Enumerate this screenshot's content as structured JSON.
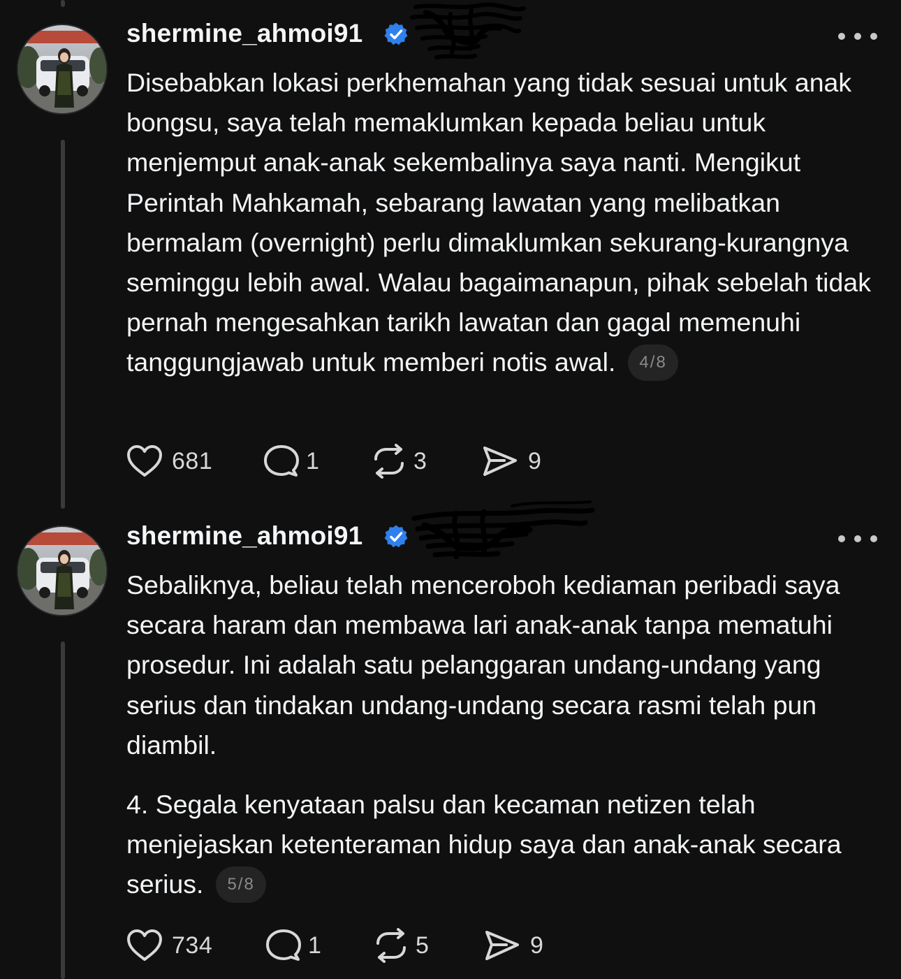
{
  "posts": [
    {
      "username": "shermine_ahmoi91",
      "verified": true,
      "paragraphs": [
        "Disebabkan lokasi perkhemahan yang tidak sesuai untuk anak bongsu, saya telah memaklumkan kepada beliau untuk menjemput anak-anak sekembalinya saya nanti. Mengikut Perintah Mahkamah, sebarang lawatan yang melibatkan bermalam (overnight) perlu dimaklumkan sekurang-kurangnya seminggu lebih awal. Walau bagaimanapun, pihak sebelah tidak pernah mengesahkan tarikh lawatan dan gagal memenuhi tanggungjawab untuk memberi notis awal."
      ],
      "page": "4/8",
      "likes": "681",
      "replies": "1",
      "reposts": "3",
      "shares": "9"
    },
    {
      "username": "shermine_ahmoi91",
      "verified": true,
      "paragraphs": [
        "Sebaliknya, beliau telah menceroboh kediaman peribadi saya secara haram dan membawa lari anak-anak tanpa mematuhi prosedur. Ini adalah satu pelanggaran undang-undang yang serius dan tindakan undang-undang secara rasmi telah pun diambil.",
        "4. Segala kenyataan palsu dan kecaman netizen telah menjejaskan ketenteraman hidup saya dan anak-anak secara serius."
      ],
      "page": "5/8",
      "likes": "734",
      "replies": "1",
      "reposts": "5",
      "shares": "9"
    }
  ],
  "icons": {
    "more": "more-horizontal-icon",
    "like": "heart-icon",
    "reply": "comment-bubble-icon",
    "repost": "repost-arrows-icon",
    "share": "send-paper-plane-icon",
    "verified": "verified-badge-icon"
  },
  "colors": {
    "background": "#101010",
    "text": "#f3f5f7",
    "verified": "#0095f6",
    "muted": "#8a8a8a"
  }
}
